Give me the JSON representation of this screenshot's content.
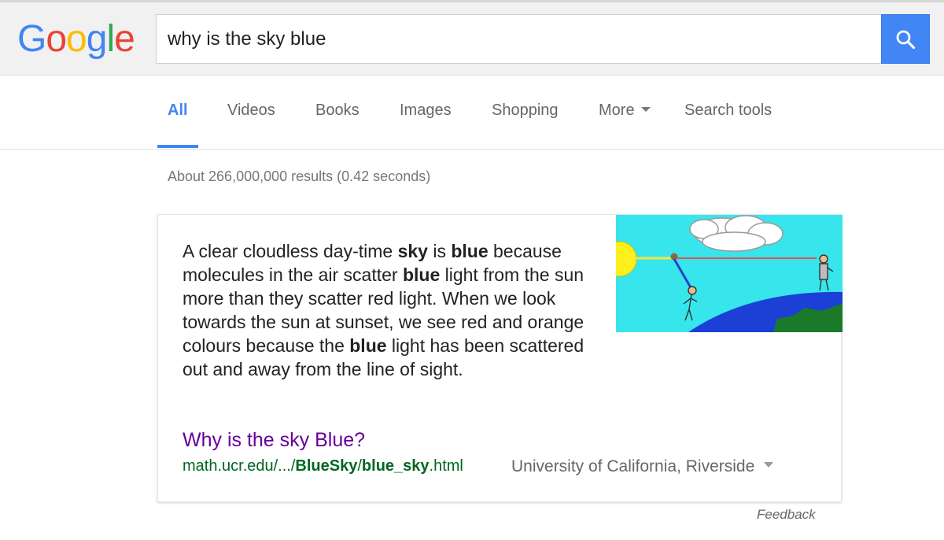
{
  "logo": {
    "letters": [
      "G",
      "o",
      "o",
      "g",
      "l",
      "e"
    ],
    "colors": [
      "#4285f4",
      "#ea4335",
      "#fbbc05",
      "#4285f4",
      "#34a853",
      "#ea4335"
    ]
  },
  "search": {
    "query": "why is the sky blue",
    "button_icon": "search-icon"
  },
  "tabs": [
    {
      "label": "All",
      "active": true
    },
    {
      "label": "Videos"
    },
    {
      "label": "Books"
    },
    {
      "label": "Images"
    },
    {
      "label": "Shopping"
    },
    {
      "label": "More",
      "icon": "caret-down-icon"
    },
    {
      "label": "Search tools"
    }
  ],
  "stats": "About 266,000,000 results (0.42 seconds)",
  "answer": {
    "snippet_parts": [
      {
        "text": "A clear cloudless day-time ",
        "bold": false
      },
      {
        "text": "sky",
        "bold": true
      },
      {
        "text": " is ",
        "bold": false
      },
      {
        "text": "blue",
        "bold": true
      },
      {
        "text": " because molecules in the air scatter ",
        "bold": false
      },
      {
        "text": "blue",
        "bold": true
      },
      {
        "text": " light from the sun more than they scatter red light. When we look towards the sun at sunset, we see red and orange colours because the ",
        "bold": false
      },
      {
        "text": "blue",
        "bold": true
      },
      {
        "text": " light has been scattered out and away from the line of sight.",
        "bold": false
      }
    ],
    "image_icon": "sky-scattering-illustration",
    "title": "Why is the sky Blue?",
    "url_parts": [
      {
        "text": "math.ucr.edu/.../",
        "bold": false
      },
      {
        "text": "BlueSky",
        "bold": true
      },
      {
        "text": "/",
        "bold": false
      },
      {
        "text": "blue_sky",
        "bold": true
      },
      {
        "text": ".html",
        "bold": false
      }
    ],
    "source": "University of California, Riverside"
  },
  "feedback": "Feedback",
  "colors": {
    "accent": "#4285f4",
    "visited_link": "#660099",
    "url_green": "#006621"
  }
}
